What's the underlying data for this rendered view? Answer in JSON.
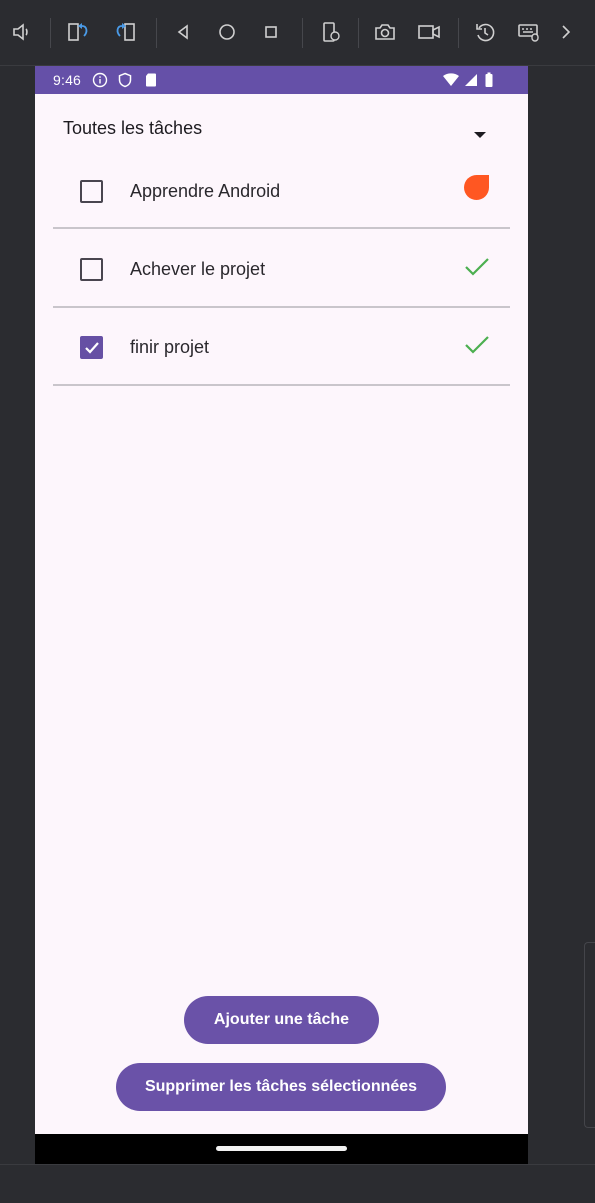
{
  "statusbar": {
    "time": "9:46",
    "icons": [
      "info-circle-icon",
      "shield-icon",
      "sd-card-icon",
      "wifi-icon",
      "signal-icon",
      "battery-icon"
    ]
  },
  "toolbar": {
    "icons": [
      "volume-icon",
      "rotate-left-icon",
      "rotate-right-icon",
      "back-icon",
      "home-icon",
      "overview-icon",
      "fold-icon",
      "screenshot-icon",
      "screen-record-icon",
      "snapshot-icon",
      "keyboard-icon",
      "more-icon"
    ]
  },
  "filter": {
    "label": "Toutes les tâches",
    "icon": "dropdown-arrow-icon"
  },
  "tasks": [
    {
      "label": "Apprendre Android",
      "checked": false,
      "status": "in-progress-icon",
      "status_color": "#ff5722"
    },
    {
      "label": "Achever le projet",
      "checked": false,
      "status": "check-icon",
      "status_color": "#4caf50"
    },
    {
      "label": "finir projet",
      "checked": true,
      "status": "check-icon",
      "status_color": "#4caf50"
    }
  ],
  "buttons": {
    "add": "Ajouter une tâche",
    "delete": "Supprimer les tâches sélectionnées"
  },
  "colors": {
    "primary": "#6650a4",
    "background": "#fdf6fc",
    "statusbar": "#6550a8"
  }
}
